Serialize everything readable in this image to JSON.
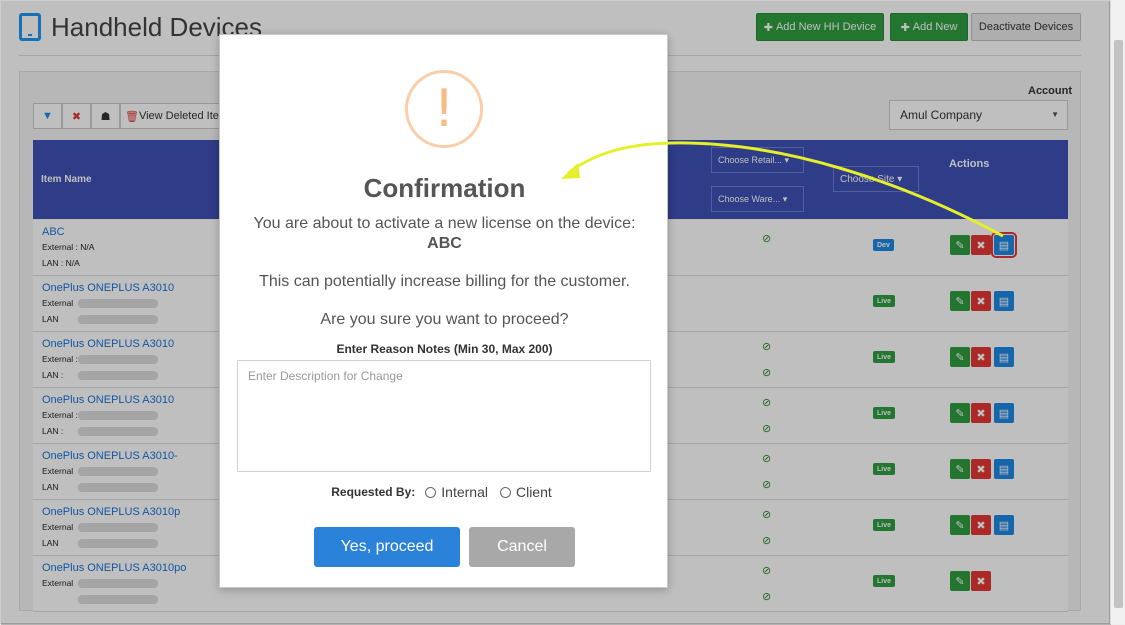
{
  "header": {
    "title": "Handheld Devices",
    "add_hh_label": "Add New HH Device",
    "add_new_label": "Add New",
    "deactivate_label": "Deactivate Devices"
  },
  "toolbar": {
    "view_deleted_label": "View Deleted Ite"
  },
  "account": {
    "label": "Account",
    "value": "Amul Company"
  },
  "table": {
    "headers": {
      "item_name": "Item Name",
      "choose_retail": "Choose Retail...",
      "choose_warehouse": "Choose Ware...",
      "choose_site": "Choose Site",
      "actions": "Actions"
    },
    "rows": [
      {
        "name": "ABC",
        "external_label": "External : N/A",
        "lan_label": "LAN      : N/A",
        "status": "Dev"
      },
      {
        "name": "OnePlus ONEPLUS A3010",
        "external_label": "External",
        "lan_label": "LAN",
        "status": "Live"
      },
      {
        "name": "OnePlus ONEPLUS A3010",
        "external_label": "External :",
        "lan_label": "LAN      :",
        "status": "Live"
      },
      {
        "name": "OnePlus ONEPLUS A3010",
        "external_label": "External :",
        "lan_label": "LAN      :",
        "status": "Live"
      },
      {
        "name": "OnePlus ONEPLUS A3010-",
        "external_label": "External",
        "lan_label": "LAN",
        "status": "Live"
      },
      {
        "name": "OnePlus ONEPLUS A3010p",
        "external_label": "External",
        "lan_label": "LAN",
        "status": "Live"
      },
      {
        "name": "OnePlus ONEPLUS A3010po",
        "external_label": "External",
        "lan_label": "",
        "status": "Live"
      }
    ]
  },
  "modal": {
    "title": "Confirmation",
    "line1": "You are about to activate a new license on the device:",
    "device": "ABC",
    "line2": "This can potentially increase billing for the customer.",
    "line3": "Are you sure you want to proceed?",
    "notes_label": "Enter Reason Notes (Min 30, Max 200)",
    "notes_placeholder": "Enter Description for Change",
    "requested_by_label": "Requested By:",
    "option_internal": "Internal",
    "option_client": "Client",
    "confirm_label": "Yes, proceed",
    "cancel_label": "Cancel"
  },
  "colors": {
    "header_blue": "#3f51b5",
    "green": "#2f9e3f",
    "confirm_blue": "#2b82d9",
    "annotation_arrow": "#e6f02a"
  }
}
